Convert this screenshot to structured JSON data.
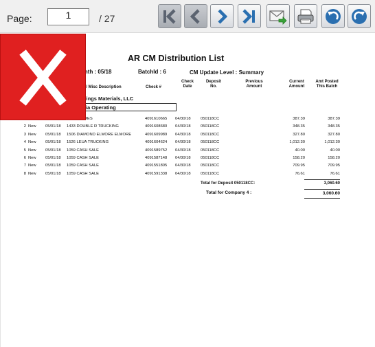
{
  "toolbar": {
    "page_label": "Page:",
    "page_value": "1",
    "page_total": "/ 27",
    "buttons": [
      {
        "name": "first-page",
        "icon": "first-page-icon",
        "enabled": false
      },
      {
        "name": "prev-page",
        "icon": "prev-page-icon",
        "enabled": false
      },
      {
        "name": "next-page",
        "icon": "next-page-icon",
        "enabled": true
      },
      {
        "name": "last-page",
        "icon": "last-page-icon",
        "enabled": true
      },
      {
        "name": "export",
        "icon": "export-icon",
        "enabled": true
      },
      {
        "name": "print",
        "icon": "print-icon",
        "enabled": true
      },
      {
        "name": "back",
        "icon": "back-icon",
        "enabled": true
      },
      {
        "name": "refresh",
        "icon": "refresh-icon",
        "enabled": true
      }
    ]
  },
  "report": {
    "title": "AR CM Distribution List",
    "month_text": "onth : 05/18",
    "batch_text": "BatchId : 6",
    "update_level": "CM Update Level : Summary",
    "col_desc": "er / Misc Description",
    "col_check": "Check #",
    "col_check_date_1": "Check",
    "col_check_date_2": "Date",
    "col_deposit_1": "Deposit",
    "col_deposit_2": "No.",
    "col_prev_1": "Previous",
    "col_prev_2": "Amount",
    "col_current_1": "Current",
    "col_current_2": "Amount",
    "col_posted_1": "Amt Posted",
    "col_posted_2": "This Batch",
    "company": "prings Materials, LLC",
    "division": "ria Operating",
    "rows": [
      {
        "seq": "",
        "status": "",
        "date": "",
        "desc": "LTON HOMES",
        "check": "4091610665",
        "check_date": "04/30/18",
        "deposit": "050118CC",
        "current": "387.39",
        "posted": "387.39"
      },
      {
        "seq": "2",
        "status": "New",
        "date": "05/01/18",
        "desc": "1433 DOUBLE R TRUCKING",
        "check": "4091608680",
        "check_date": "04/30/18",
        "deposit": "050118CC",
        "current": "348.35",
        "posted": "348.35"
      },
      {
        "seq": "3",
        "status": "New",
        "date": "05/01/18",
        "desc": "1506 DIAMOND ELMORE  ELMORE",
        "check": "4091609989",
        "check_date": "04/30/18",
        "deposit": "050118CC",
        "current": "327.80",
        "posted": "327.80"
      },
      {
        "seq": "4",
        "status": "New",
        "date": "05/01/18",
        "desc": "1526 LEUA TRUCKING",
        "check": "4091604624",
        "check_date": "04/30/18",
        "deposit": "050118CC",
        "current": "1,012.30",
        "posted": "1,012.30"
      },
      {
        "seq": "5",
        "status": "New",
        "date": "05/01/18",
        "desc": "1059 CASH SALE",
        "check": "4091589752",
        "check_date": "04/30/18",
        "deposit": "050118CC",
        "current": "40.00",
        "posted": "40.00"
      },
      {
        "seq": "6",
        "status": "New",
        "date": "05/01/18",
        "desc": "1059 CASH SALE",
        "check": "4091587148",
        "check_date": "04/30/18",
        "deposit": "050118CC",
        "current": "158.20",
        "posted": "158.20"
      },
      {
        "seq": "7",
        "status": "New",
        "date": "05/01/18",
        "desc": "1059 CASH SALE",
        "check": "4091551805",
        "check_date": "04/30/18",
        "deposit": "050118CC",
        "current": "709.95",
        "posted": "709.95"
      },
      {
        "seq": "8",
        "status": "New",
        "date": "05/01/18",
        "desc": "1059 CASH SALE",
        "check": "4091591338",
        "check_date": "04/30/18",
        "deposit": "050118CC",
        "current": "76.61",
        "posted": "76.61"
      }
    ],
    "total_deposit_label": "Total for Deposit  050118CC:",
    "total_deposit_value": "3,060.60",
    "total_company_label": "Total for Company  4 :",
    "total_company_value": "3,060.60"
  },
  "overlay": {
    "icon": "error-x-icon",
    "color": "#e02020"
  }
}
